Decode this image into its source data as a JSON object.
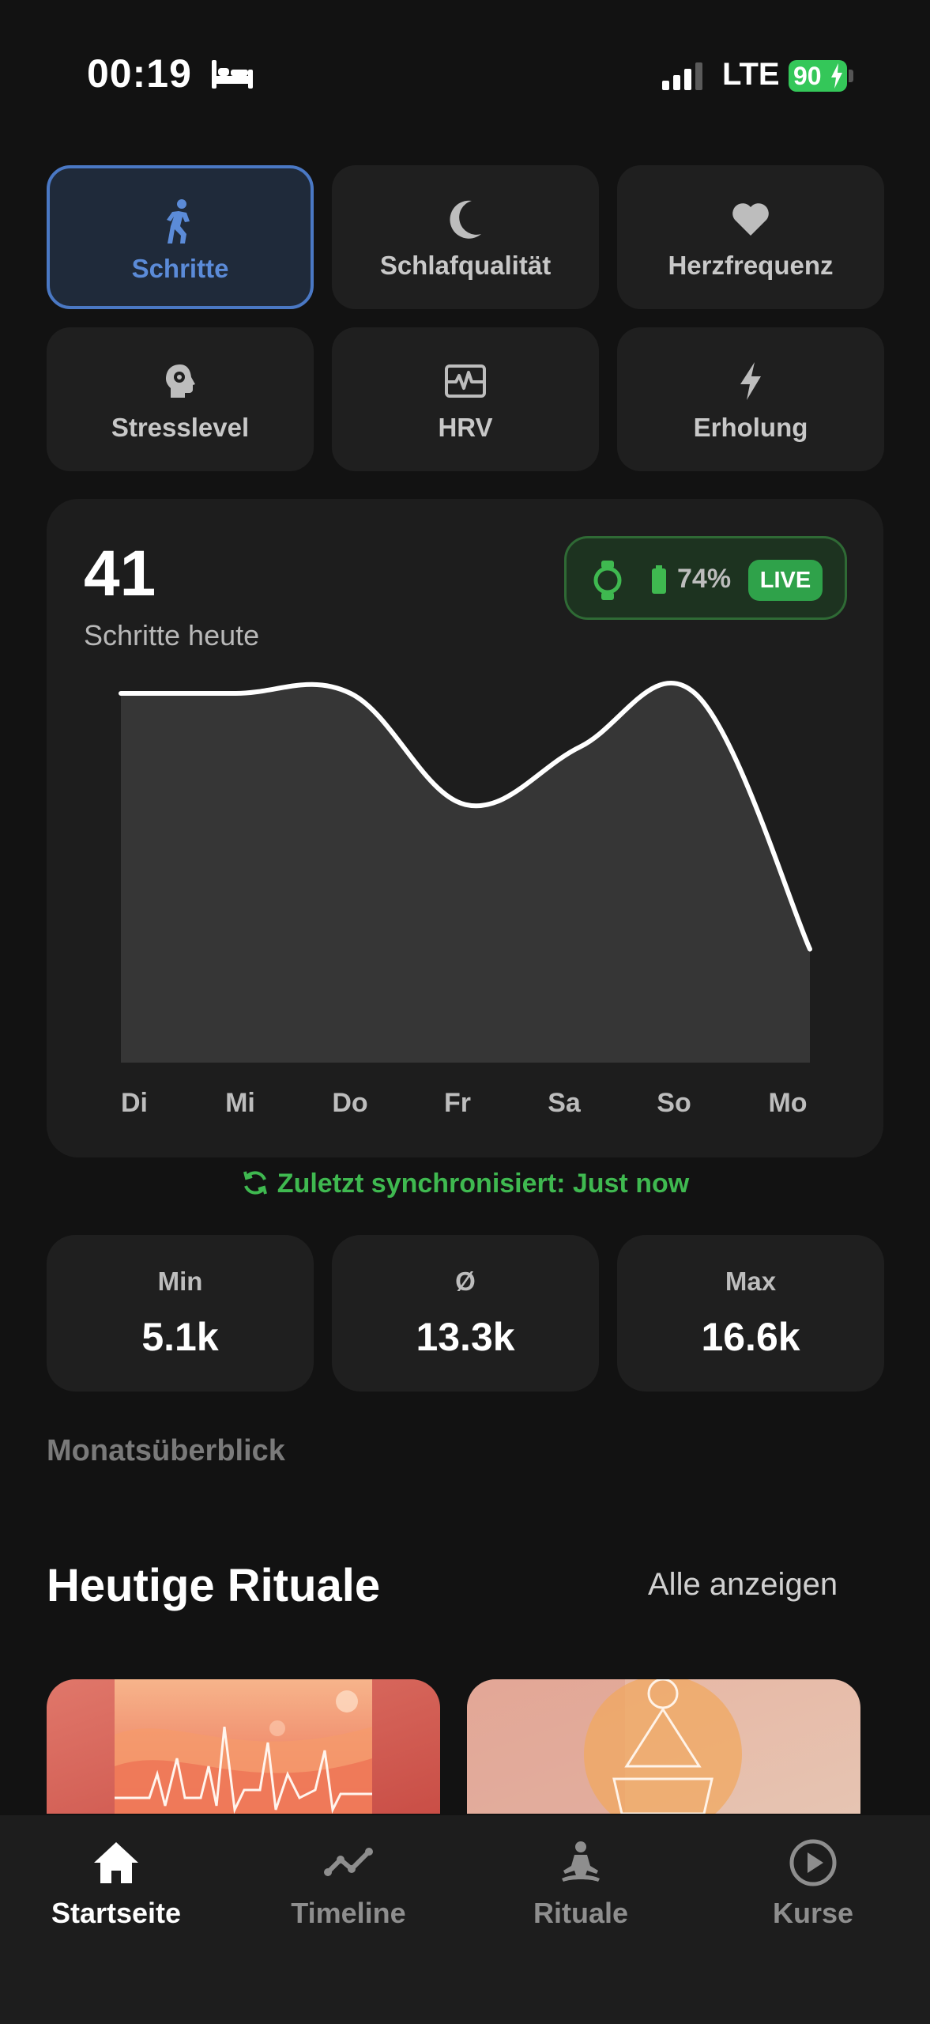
{
  "status_bar": {
    "time": "00:19",
    "network": "LTE",
    "battery": "90"
  },
  "metrics": [
    {
      "label": "Schritte",
      "icon": "walking-icon",
      "active": true
    },
    {
      "label": "Schlafqualität",
      "icon": "moon-icon",
      "active": false
    },
    {
      "label": "Herzfrequenz",
      "icon": "heart-icon",
      "active": false
    },
    {
      "label": "Stresslevel",
      "icon": "head-gear-icon",
      "active": false
    },
    {
      "label": "HRV",
      "icon": "hrv-wave-icon",
      "active": false
    },
    {
      "label": "Erholung",
      "icon": "bolt-icon",
      "active": false
    }
  ],
  "summary": {
    "value": "41",
    "label": "Schritte heute"
  },
  "device": {
    "battery": "74%",
    "status": "LIVE"
  },
  "chart_data": {
    "type": "area",
    "categories": [
      "Di",
      "Mi",
      "Do",
      "Fr",
      "Sa",
      "So",
      "Mo"
    ],
    "series": [
      {
        "values": [
          16.6,
          16.6,
          16.6,
          11.6,
          14.2,
          16.6,
          5.1
        ]
      }
    ],
    "ylim": [
      0,
      16.6
    ]
  },
  "sync_text": "Zuletzt synchronisiert: Just now",
  "stats": [
    {
      "label": "Min",
      "value": "5.1k"
    },
    {
      "label": "Ø",
      "value": "13.3k"
    },
    {
      "label": "Max",
      "value": "16.6k"
    }
  ],
  "month_label": "Monatsüberblick",
  "rituals": {
    "title": "Heutige Rituale",
    "see_all": "Alle anzeigen"
  },
  "tabs": [
    {
      "label": "Startseite",
      "icon": "home-icon",
      "active": true
    },
    {
      "label": "Timeline",
      "icon": "timeline-icon",
      "active": false
    },
    {
      "label": "Rituale",
      "icon": "meditation-icon",
      "active": false
    },
    {
      "label": "Kurse",
      "icon": "play-circle-icon",
      "active": false
    }
  ],
  "colors": {
    "accent_blue": "#5b8bd8",
    "accent_green": "#3fb950",
    "background": "#121212",
    "card": "#1f1f1f"
  }
}
